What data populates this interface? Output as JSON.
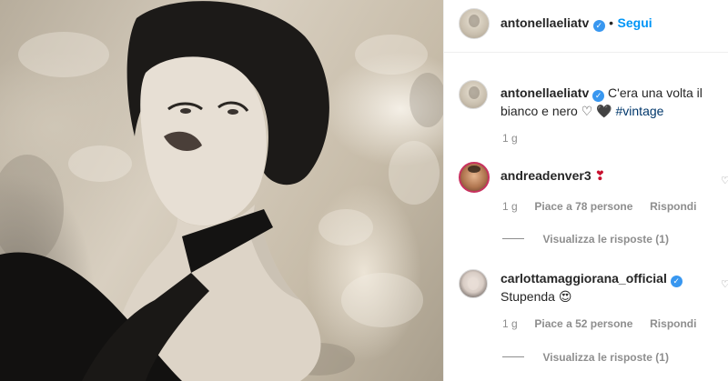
{
  "post": {
    "author": "antonellaeliatv",
    "follow_label": "Segui",
    "separator": "•",
    "caption_line1": "C'era una volta il",
    "caption_line2": "bianco e nero",
    "caption_emojis": "♡ 🖤",
    "hashtag": "#vintage",
    "caption_time": "1 g"
  },
  "comments": [
    {
      "user": "andreadenver3",
      "text": "",
      "emoji": "❣",
      "time": "1 g",
      "likes": "Piace a 78 persone",
      "reply": "Rispondi",
      "view_replies": "Visualizza le risposte (1)"
    },
    {
      "user": "carlottamaggiorana_official",
      "text": "Stupenda",
      "emoji": "😍",
      "time": "1 g",
      "likes": "Piace a 52 persone",
      "reply": "Rispondi",
      "view_replies": "Visualizza le risposte (1)"
    }
  ],
  "colors": {
    "accent": "#0095f6",
    "verified": "#3897f0",
    "muted": "#8e8e8e"
  },
  "icons": {
    "verified": "verified-badge-icon",
    "like": "heart-icon"
  }
}
